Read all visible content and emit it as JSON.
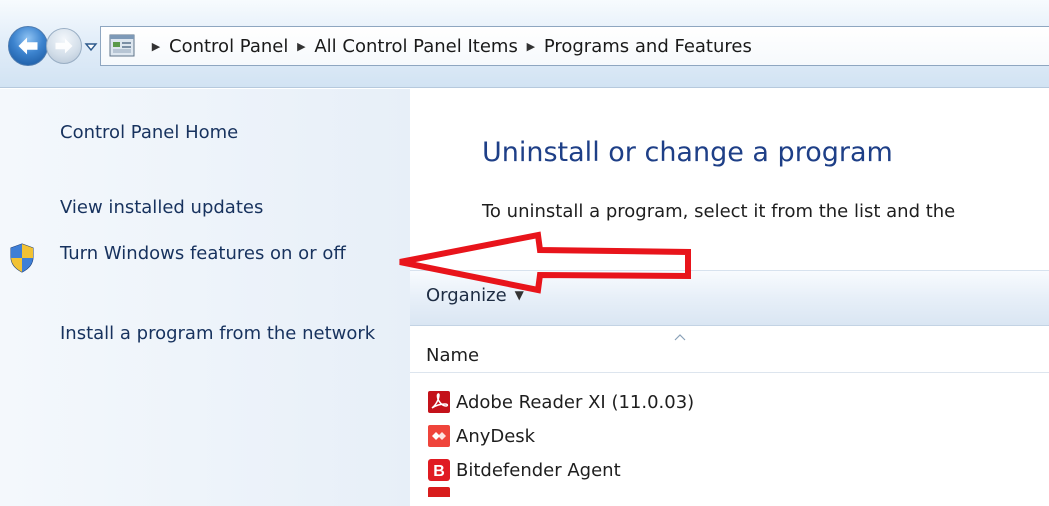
{
  "address_bar": {
    "breadcrumbs": [
      "Control Panel",
      "All Control Panel Items",
      "Programs and Features"
    ]
  },
  "left_pane": {
    "control_panel_home": "Control Panel Home",
    "view_installed_updates": "View installed updates",
    "turn_windows_features": "Turn Windows features on or off",
    "install_from_network": "Install a program from the network"
  },
  "main": {
    "title": "Uninstall or change a program",
    "instructions": "To uninstall a program, select it from the list and the",
    "toolbar": {
      "organize_label": "Organize"
    },
    "list": {
      "columns": [
        "Name"
      ],
      "programs": [
        {
          "name": "Adobe Reader XI (11.0.03)",
          "icon": "adobe-reader-icon"
        },
        {
          "name": "AnyDesk",
          "icon": "anydesk-icon"
        },
        {
          "name": "Bitdefender Agent",
          "icon": "bitdefender-icon"
        }
      ]
    }
  },
  "colors": {
    "link": "#17325e",
    "title": "#1e3f87",
    "annotation_arrow": "#e8141b"
  }
}
